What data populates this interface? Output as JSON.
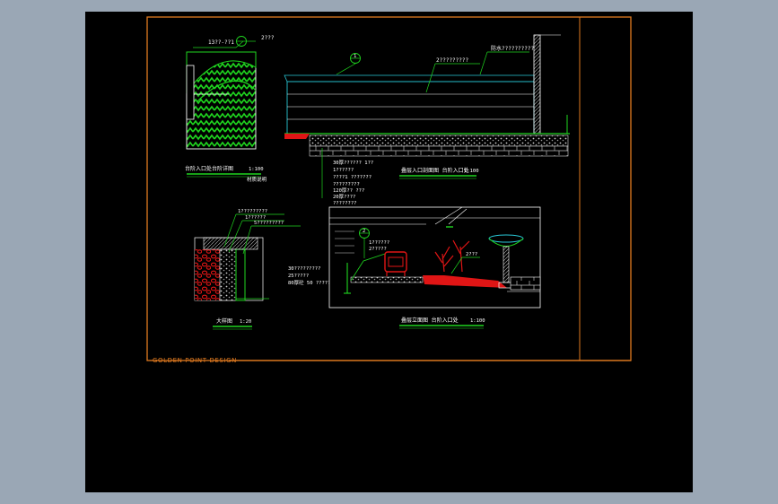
{
  "brand": "GOLDEN POINT DESIGN",
  "colors": {
    "frame": "#e07a20",
    "line_green": "#1fd61f",
    "line_cyan": "#29c7d6",
    "accent_red": "#e01515",
    "background": "#000000",
    "outer_bg": "#9aa7b5"
  },
  "detail_a": {
    "callouts": [
      "13??-??1",
      "2???"
    ],
    "title": "台阶入口处台阶详图",
    "scale": "1:100",
    "note": "材质说明"
  },
  "section_main": {
    "callouts": [
      "2?????????",
      "防水??????????"
    ],
    "layers": [
      "30厚??????  1??",
      "1??????",
      "????1    ???????",
      "?????????",
      "120厚?? ???",
      "20厚????",
      "????????",
      "????"
    ],
    "title": "叠层入口剖面图 台阶入口处",
    "scale": "1:100",
    "marker": "1"
  },
  "detail_b": {
    "callouts": [
      "1?????????",
      "1??????",
      "5?????????"
    ],
    "side_notes": [
      "30?????????",
      "25?????",
      "80厚砼 50  ??????"
    ],
    "title": "大样图",
    "scale": "1:20"
  },
  "section_b": {
    "callouts": [
      "1??????",
      "2?????",
      "2???"
    ],
    "title": "叠层立面图 台阶入口处",
    "scale": "1:100",
    "marker": "2"
  }
}
